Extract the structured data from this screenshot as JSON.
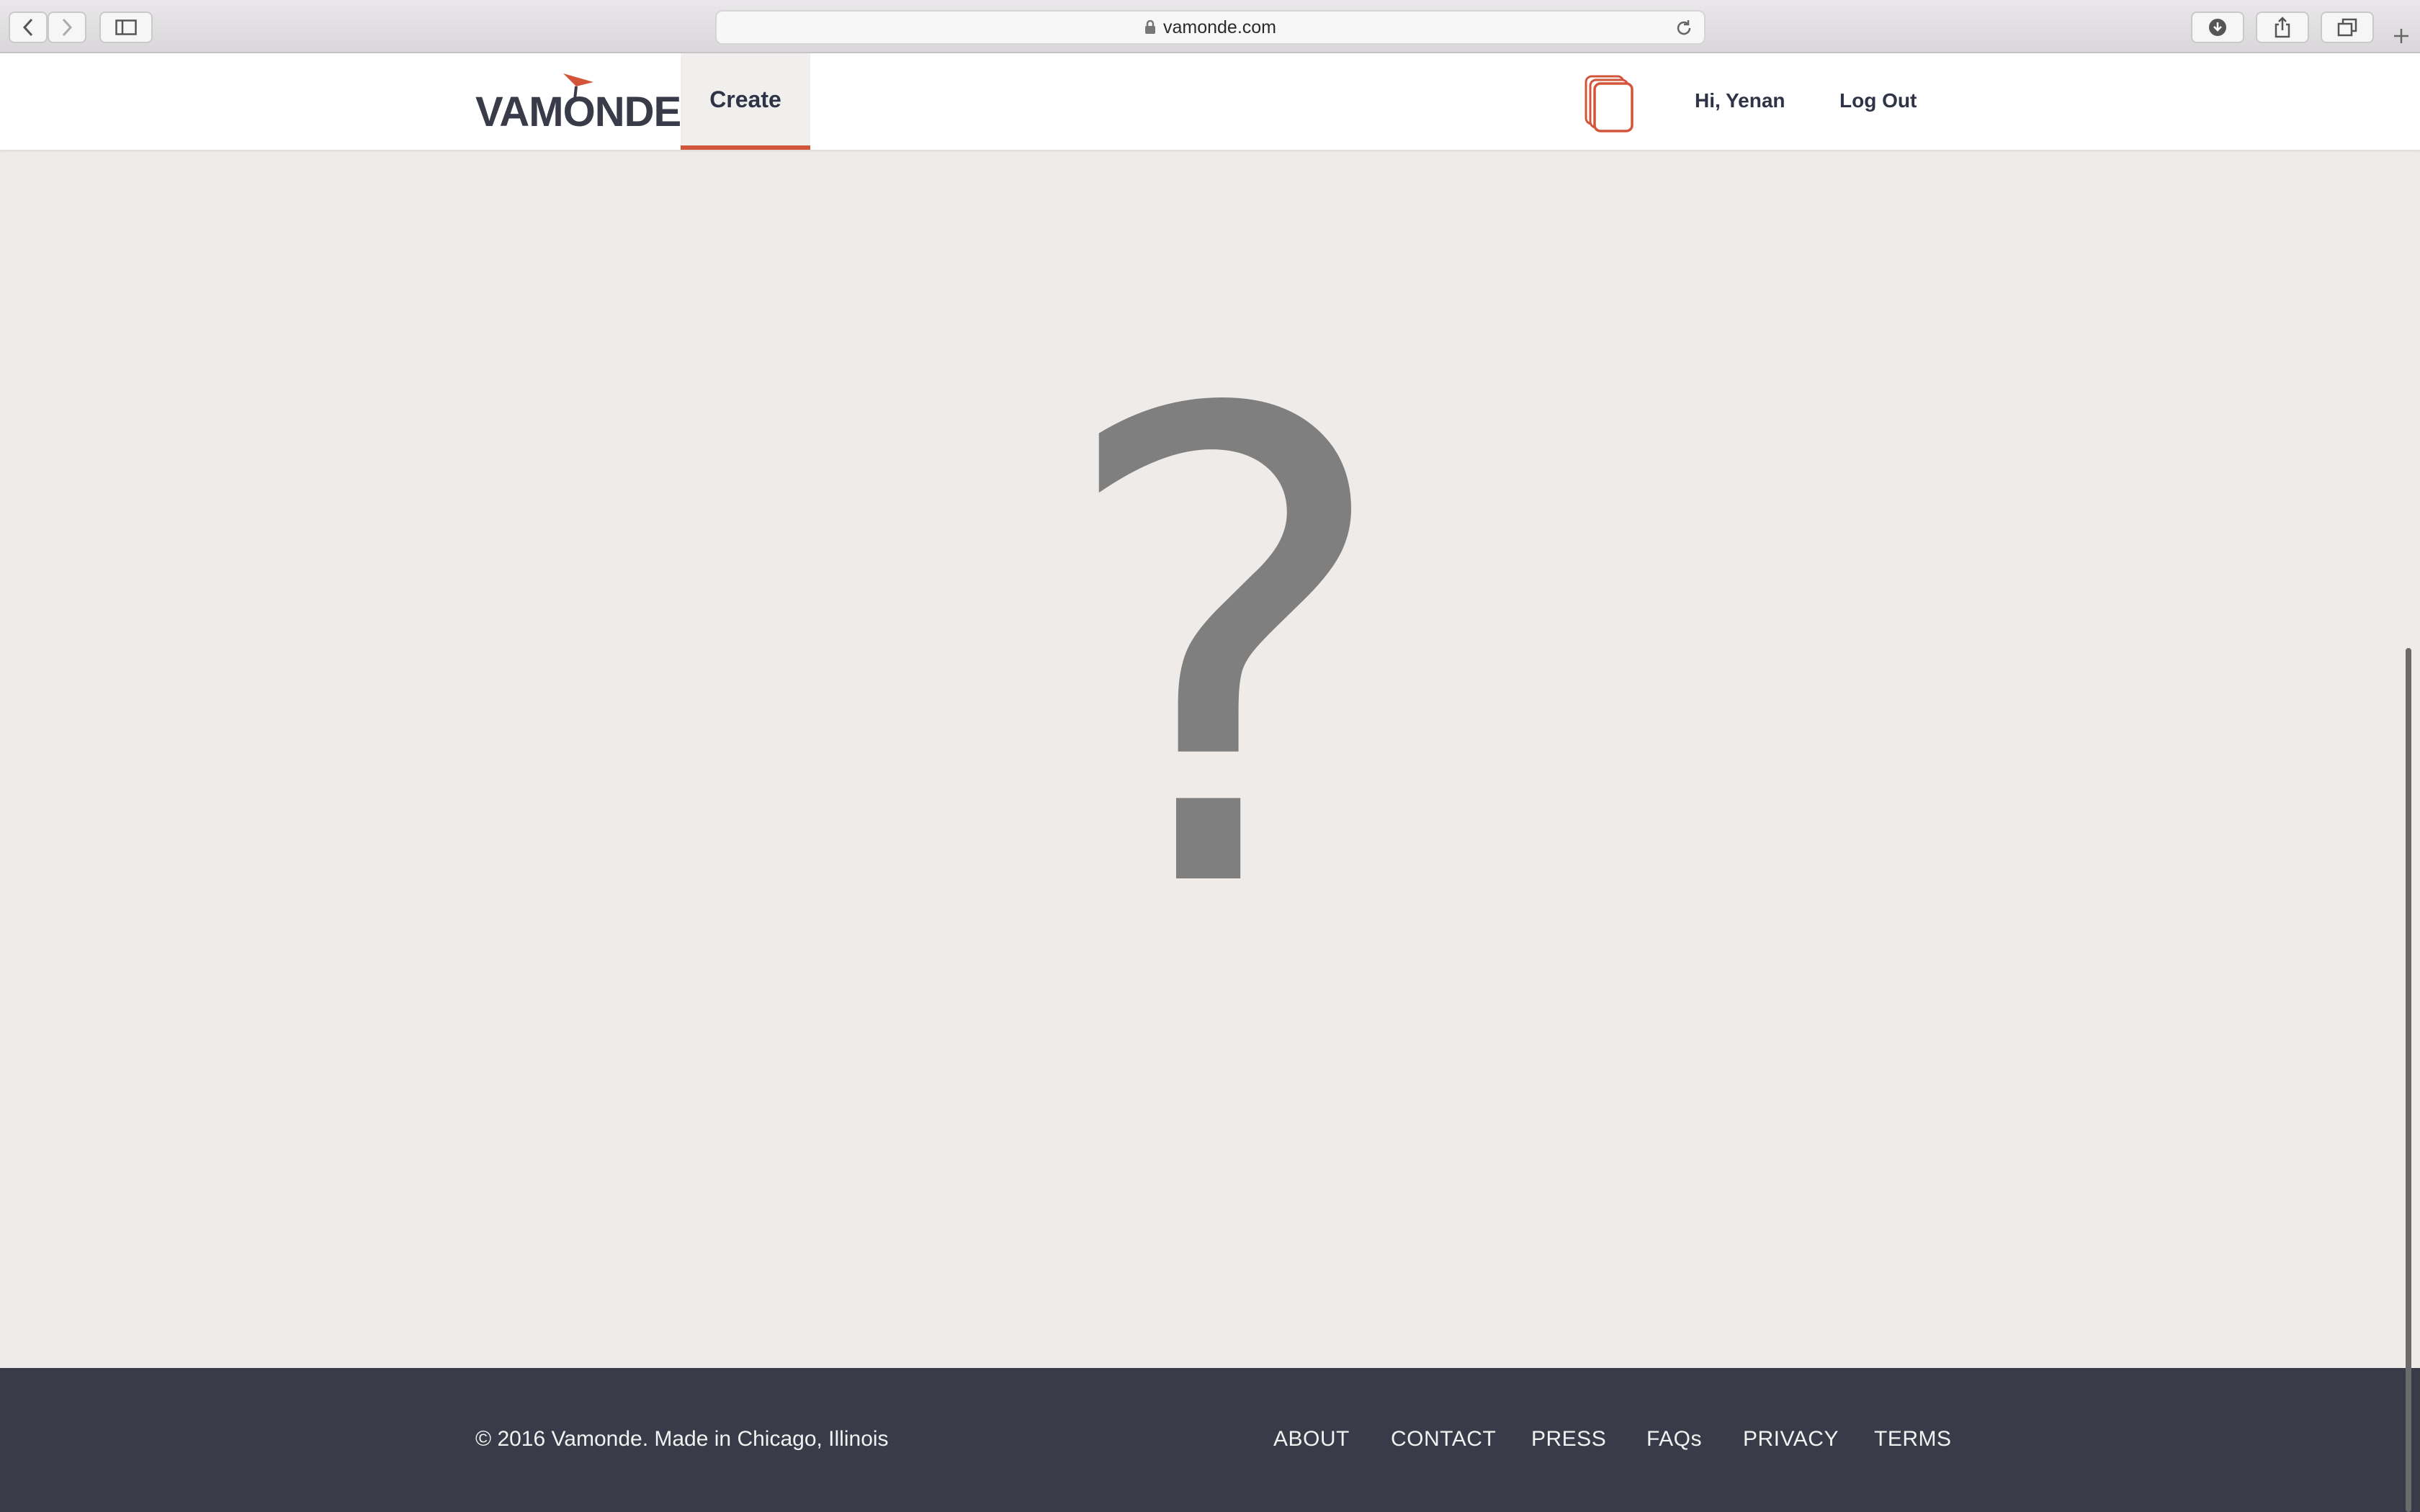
{
  "browser": {
    "url": "vamonde.com",
    "icons": {
      "back": "chevron-left-icon",
      "forward": "chevron-right-icon",
      "sidebar": "sidebar-icon",
      "lock": "lock-icon",
      "reload": "reload-icon",
      "downloads": "download-icon",
      "share": "share-icon",
      "tabs": "tabs-icon",
      "new_tab": "plus-icon"
    }
  },
  "header": {
    "logo_text": "VAMONDE",
    "nav": {
      "create": "Create"
    },
    "greeting": "Hi, Yenan",
    "logout": "Log Out",
    "stack_icon": "stacked-cards-icon"
  },
  "main": {
    "placeholder_glyph": "?"
  },
  "footer": {
    "copyright": "© 2016 Vamonde. Made in Chicago, Illinois",
    "links": [
      "ABOUT",
      "CONTACT",
      "PRESS",
      "FAQs",
      "PRIVACY",
      "TERMS"
    ]
  },
  "colors": {
    "accent": "#d2553a",
    "navy": "#2e3346",
    "footer_bg": "#3a3b48",
    "page_bg": "#efebe8"
  }
}
